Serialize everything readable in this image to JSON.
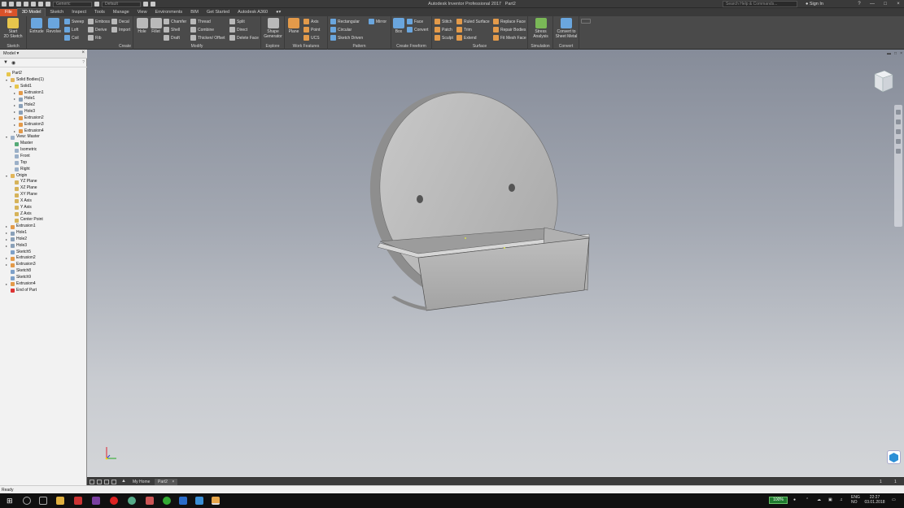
{
  "title_bar": {
    "app_title": "Autodesk Inventor Professional 2017",
    "document": "Part2",
    "material_select": "Generic",
    "appearance_select": "Default",
    "help_search_placeholder": "Search Help & Commands...",
    "sign_in": "Sign In",
    "help": "?"
  },
  "tabs": [
    "File",
    "3D Model",
    "Sketch",
    "Inspect",
    "Tools",
    "Manage",
    "View",
    "Environments",
    "BIM",
    "Get Started",
    "Autodesk A360"
  ],
  "active_tab": "3D Model",
  "ribbon": {
    "sketch": {
      "label": "Sketch",
      "start": "Start",
      "start2": "2D Sketch"
    },
    "create": {
      "label": "Create",
      "extrude": "Extrude",
      "revolve": "Revolve",
      "sweep": "Sweep",
      "loft": "Loft",
      "coil": "Coil",
      "emboss": "Emboss",
      "derive": "Derive",
      "rib": "Rib",
      "decal": "Decal",
      "import": "Import"
    },
    "modify": {
      "label": "Modify",
      "hole": "Hole",
      "fillet": "Fillet",
      "chamfer": "Chamfer",
      "shell": "Shell",
      "draft": "Draft",
      "thread": "Thread",
      "combine": "Combine",
      "thicken": "Thicken/ Offset",
      "split": "Split",
      "direct": "Direct",
      "delete_face": "Delete Face"
    },
    "explore": {
      "label": "Explore",
      "shape": "Shape",
      "generator": "Generator"
    },
    "work_features": {
      "label": "Work Features",
      "plane": "Plane",
      "axis": "Axis",
      "point": "Point",
      "ucs": "UCS"
    },
    "pattern": {
      "label": "Pattern",
      "rectangular": "Rectangular",
      "circular": "Circular",
      "sketch_driven": "Sketch Driven",
      "mirror": "Mirror"
    },
    "freeform": {
      "label": "Create Freeform",
      "box": "Box",
      "face": "Face",
      "convert": "Convert"
    },
    "surface": {
      "label": "Surface",
      "stitch": "Stitch",
      "patch": "Patch",
      "sculpt": "Sculpt",
      "ruled": "Ruled Surface",
      "trim": "Trim",
      "extend": "Extend",
      "replace": "Replace Face",
      "repair": "Repair Bodies",
      "fitmesh": "Fit Mesh Face"
    },
    "simulation": {
      "label": "Simulation",
      "stress": "Stress",
      "analysis": "Analysis"
    },
    "convert": {
      "label": "Convert",
      "c1": "Convert to",
      "c2": "Sheet Metal"
    }
  },
  "browser": {
    "title": "Model",
    "close": "×",
    "help": "?",
    "items": [
      {
        "label": "Part2",
        "depth": 0,
        "icon": "part"
      },
      {
        "label": "Solid Bodies(1)",
        "depth": 1,
        "icon": "folder",
        "tw": "▾"
      },
      {
        "label": "Solid1",
        "depth": 2,
        "icon": "solid",
        "tw": "▾"
      },
      {
        "label": "Extrusion1",
        "depth": 3,
        "icon": "feature",
        "tw": "▸"
      },
      {
        "label": "Hole1",
        "depth": 3,
        "icon": "hole",
        "tw": "▸"
      },
      {
        "label": "Hole2",
        "depth": 3,
        "icon": "hole",
        "tw": "▸"
      },
      {
        "label": "Hole3",
        "depth": 3,
        "icon": "hole",
        "tw": "▸"
      },
      {
        "label": "Extrusion2",
        "depth": 3,
        "icon": "feature",
        "tw": "▸"
      },
      {
        "label": "Extrusion3",
        "depth": 3,
        "icon": "feature",
        "tw": "▸"
      },
      {
        "label": "Extrusion4",
        "depth": 3,
        "icon": "feature",
        "tw": "▸"
      },
      {
        "label": "View: Master",
        "depth": 1,
        "icon": "view",
        "tw": "▾"
      },
      {
        "label": "Master",
        "depth": 2,
        "icon": "check"
      },
      {
        "label": "Isometric",
        "depth": 2,
        "icon": "view"
      },
      {
        "label": "Front",
        "depth": 2,
        "icon": "view"
      },
      {
        "label": "Top",
        "depth": 2,
        "icon": "view"
      },
      {
        "label": "Right",
        "depth": 2,
        "icon": "view"
      },
      {
        "label": "Origin",
        "depth": 1,
        "icon": "folder",
        "tw": "▾"
      },
      {
        "label": "YZ Plane",
        "depth": 2,
        "icon": "plane"
      },
      {
        "label": "XZ Plane",
        "depth": 2,
        "icon": "plane"
      },
      {
        "label": "XY Plane",
        "depth": 2,
        "icon": "plane"
      },
      {
        "label": "X Axis",
        "depth": 2,
        "icon": "axis"
      },
      {
        "label": "Y Axis",
        "depth": 2,
        "icon": "axis"
      },
      {
        "label": "Z Axis",
        "depth": 2,
        "icon": "axis"
      },
      {
        "label": "Center Point",
        "depth": 2,
        "icon": "point"
      },
      {
        "label": "Extrusion1",
        "depth": 1,
        "icon": "feature",
        "tw": "▸"
      },
      {
        "label": "Hole1",
        "depth": 1,
        "icon": "hole",
        "tw": "▸"
      },
      {
        "label": "Hole2",
        "depth": 1,
        "icon": "hole",
        "tw": "▸"
      },
      {
        "label": "Hole3",
        "depth": 1,
        "icon": "hole",
        "tw": "▸"
      },
      {
        "label": "Sketch5",
        "depth": 1,
        "icon": "sketch"
      },
      {
        "label": "Extrusion2",
        "depth": 1,
        "icon": "feature",
        "tw": "▸"
      },
      {
        "label": "Extrusion3",
        "depth": 1,
        "icon": "feature",
        "tw": "▸"
      },
      {
        "label": "Sketch8",
        "depth": 1,
        "icon": "sketch"
      },
      {
        "label": "Sketch9",
        "depth": 1,
        "icon": "sketch"
      },
      {
        "label": "Extrusion4",
        "depth": 1,
        "icon": "feature",
        "tw": "▸"
      },
      {
        "label": "End of Part",
        "depth": 1,
        "icon": "end"
      }
    ]
  },
  "doc_tabs": {
    "home": "My Home",
    "part": "Part2",
    "close": "×",
    "page_a": "1",
    "page_b": "1"
  },
  "status": "Ready",
  "taskbar": {
    "battery": "100%",
    "lang1": "ENG",
    "lang2": "NO",
    "time": "22:27",
    "date": "03.01.2018"
  },
  "colors": {
    "file_tab": "#d9532a",
    "ribbon_bg": "#4a4a4a",
    "viewport_top": "#868c99",
    "viewport_bottom": "#d3d5d8",
    "part": "#b5b5b5"
  }
}
